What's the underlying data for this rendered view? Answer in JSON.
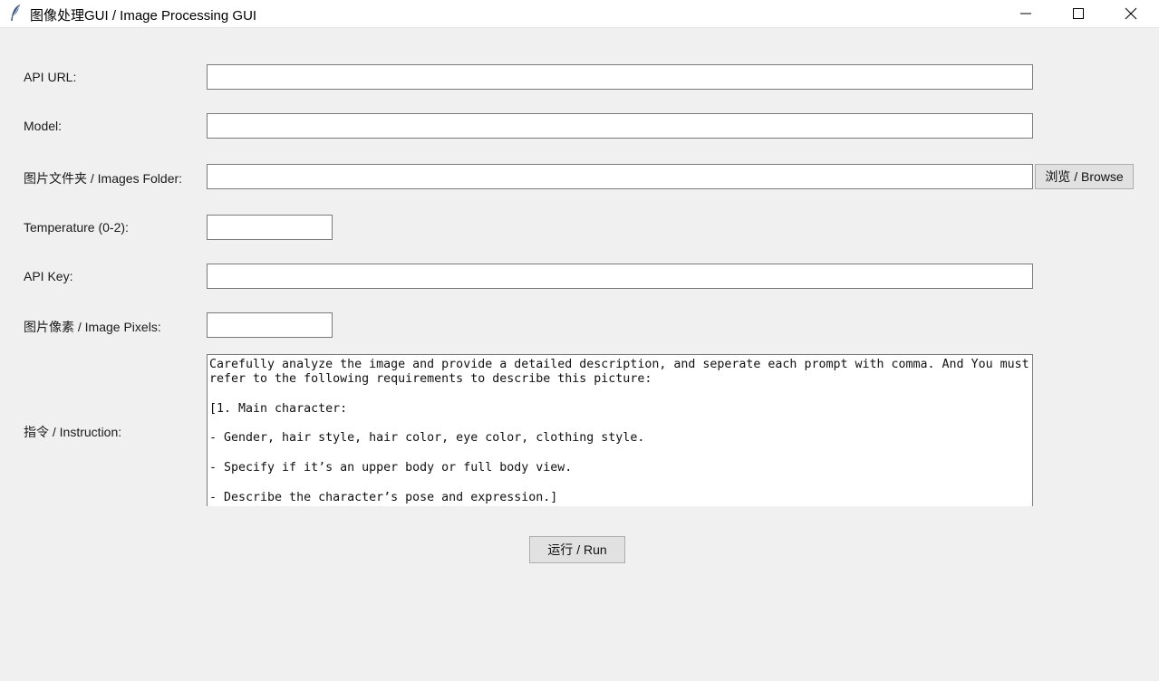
{
  "window": {
    "title": "图像处理GUI / Image Processing GUI",
    "icon": "feather-icon"
  },
  "titlebar_buttons": {
    "minimize": "minimize-icon",
    "maximize": "maximize-icon",
    "close": "close-icon"
  },
  "form": {
    "api_url": {
      "label": "API URL:",
      "value": ""
    },
    "model": {
      "label": "Model:",
      "value": ""
    },
    "images_folder": {
      "label": "图片文件夹 / Images Folder:",
      "value": "",
      "browse_label": "浏览 / Browse"
    },
    "temperature": {
      "label": "Temperature (0-2):",
      "value": ""
    },
    "api_key": {
      "label": "API Key:",
      "value": ""
    },
    "image_pixels": {
      "label": "图片像素 / Image Pixels:",
      "value": ""
    },
    "instruction": {
      "label": "指令 / Instruction:",
      "value": "Carefully analyze the image and provide a detailed description, and seperate each prompt with comma. And You must refer to the following requirements to describe this picture:\n\n[1. Main character:\n\n- Gender, hair style, hair color, eye color, clothing style.\n\n- Specify if it’s an upper body or full body view.\n\n- Describe the character’s pose and expression.]"
    },
    "run_label": "运行 / Run"
  }
}
